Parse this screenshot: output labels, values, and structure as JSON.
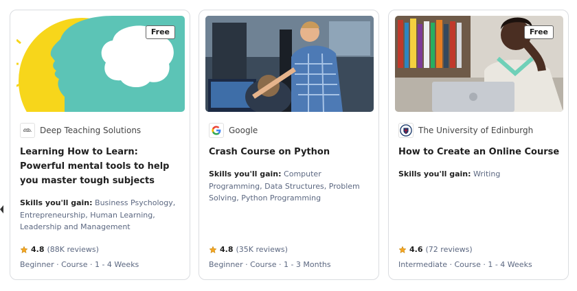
{
  "colors": {
    "star": "#f5a623",
    "text_primary": "#1f1f1f",
    "text_secondary": "#5b6780",
    "card_border": "#dadce0"
  },
  "skills_label": "Skills you'll gain:",
  "cards": [
    {
      "badge": "Free",
      "partner": {
        "name": "Deep Teaching Solutions",
        "logo_text": "dtlb.",
        "icon": "deep-teaching-solutions-logo"
      },
      "title": "Learning How to Learn: Powerful mental tools to help you master tough subjects",
      "skills": "Business Psychology, Entrepreneurship, Human Learning, Leadership and Management",
      "rating": "4.8",
      "reviews": "(88K reviews)",
      "meta": "Beginner · Course · 1 - 4 Weeks",
      "image": "head-silhouette-illustration"
    },
    {
      "badge": "",
      "partner": {
        "name": "Google",
        "icon": "google-logo"
      },
      "title": "Crash Course on Python",
      "skills": "Computer Programming, Data Structures, Problem Solving, Python Programming",
      "rating": "4.8",
      "reviews": "(35K reviews)",
      "meta": "Beginner · Course · 1 - 3 Months",
      "image": "people-at-computer-photo"
    },
    {
      "badge": "Free",
      "partner": {
        "name": "The University of Edinburgh",
        "icon": "edinburgh-crest-logo"
      },
      "title": "How to Create an Online Course",
      "skills": "Writing",
      "rating": "4.6",
      "reviews": "(72 reviews)",
      "meta": "Intermediate · Course · 1 - 4 Weeks",
      "image": "woman-with-laptop-photo"
    }
  ]
}
